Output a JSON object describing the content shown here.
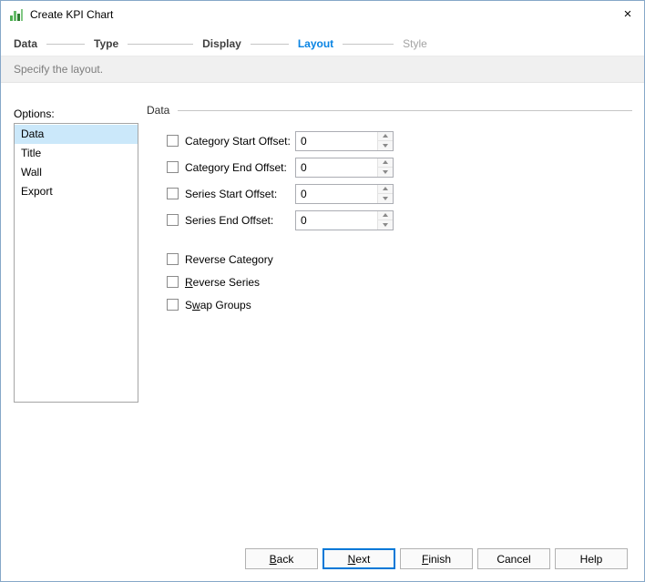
{
  "window": {
    "title": "Create KPI Chart"
  },
  "icons": {
    "close": "×"
  },
  "colors": {
    "accent": "#0984e3",
    "selection": "#cbe8fa",
    "subtitle_bg": "#f0f0f0"
  },
  "steps": [
    {
      "label": "Data"
    },
    {
      "label": "Type"
    },
    {
      "label": "Display"
    },
    {
      "label": "Layout"
    },
    {
      "label": "Style"
    }
  ],
  "subtitle": "Specify the layout.",
  "options": {
    "label": "Options:",
    "selected": "Data",
    "items": [
      {
        "label": "Data"
      },
      {
        "label": "Title"
      },
      {
        "label": "Wall"
      },
      {
        "label": "Export"
      }
    ]
  },
  "panel": {
    "header": "Data",
    "offset_rows": [
      {
        "label": "Category Start Offset:",
        "value": "0",
        "checked": false
      },
      {
        "label": "Category End Offset:",
        "value": "0",
        "checked": false
      },
      {
        "label": "Series Start Offset:",
        "value": "0",
        "checked": false
      },
      {
        "label": "Series End Offset:",
        "value": "0",
        "checked": false
      }
    ],
    "check_rows": [
      {
        "pre": "Reverse Category",
        "key": "",
        "post": "",
        "checked": false
      },
      {
        "pre": "",
        "key": "R",
        "post": "everse Series",
        "checked": false
      },
      {
        "pre": "S",
        "key": "w",
        "post": "ap Groups",
        "checked": false
      }
    ]
  },
  "buttons": {
    "back": {
      "pre": "",
      "key": "B",
      "post": "ack"
    },
    "next": {
      "pre": "",
      "key": "N",
      "post": "ext"
    },
    "finish": {
      "pre": "",
      "key": "F",
      "post": "inish"
    },
    "cancel": {
      "pre": "Cancel",
      "key": "",
      "post": ""
    },
    "help": {
      "pre": "Help",
      "key": "",
      "post": ""
    }
  }
}
